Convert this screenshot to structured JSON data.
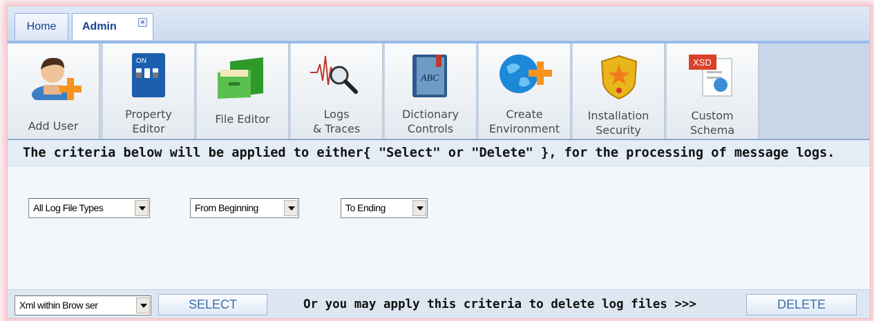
{
  "tabs": [
    {
      "label": "Home"
    },
    {
      "label": "Admin",
      "close": "×"
    }
  ],
  "toolbar": {
    "items": [
      {
        "label": "Add User",
        "icon": "add-user-icon"
      },
      {
        "label": "Property\nEditor",
        "icon": "switch-panel-icon"
      },
      {
        "label": "File Editor",
        "icon": "file-cabinet-icon"
      },
      {
        "label": "Logs\n& Traces",
        "icon": "waveform-magnifier-icon"
      },
      {
        "label": "Dictionary\nControls",
        "icon": "dictionary-book-icon"
      },
      {
        "label": "Create\nEnvironment",
        "icon": "globe-add-icon"
      },
      {
        "label": "Installation\nSecurity",
        "icon": "security-badge-icon"
      },
      {
        "label": "Custom\nSchema",
        "icon": "xsd-schema-icon"
      }
    ],
    "icon_text": {
      "on": "ON",
      "abc": "ABC",
      "xsd": "XSD"
    }
  },
  "criteria": {
    "text": "The criteria below will be applied to either{ \"Select\" or \"Delete\" }, for the processing of message logs.",
    "file_type": "All Log File Types",
    "from": "From Beginning",
    "to": "To Ending"
  },
  "bottom": {
    "output_format": "Xml within Brow ser",
    "select_label": "SELECT",
    "delete_text": "Or you may apply this criteria to delete log files >>>",
    "delete_label": "DELETE"
  },
  "colors": {
    "accent": "#15428b",
    "tab_border": "#99bbe8",
    "frame_glow": "#f3c2c8"
  }
}
